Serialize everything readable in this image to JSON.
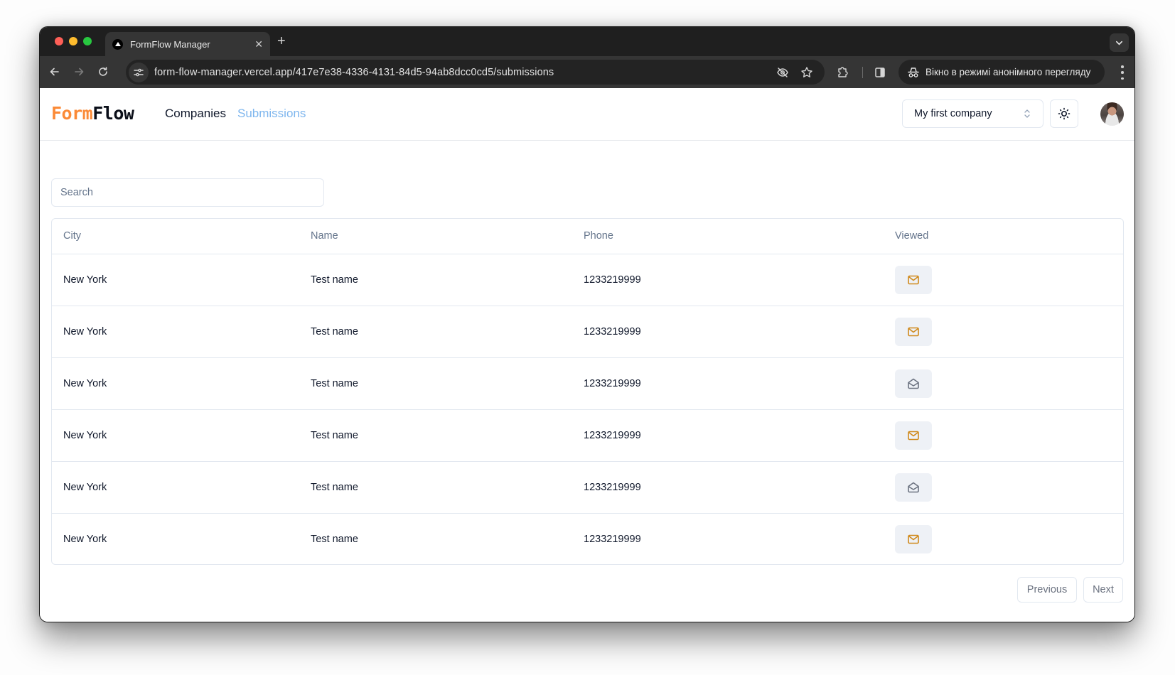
{
  "browser": {
    "tab_title": "FormFlow Manager",
    "url": "form-flow-manager.vercel.app/417e7e38-4336-4131-84d5-94ab8dcc0cd5/submissions",
    "incognito_label": "Вікно в режимі анонімного перегляду"
  },
  "app": {
    "logo_part1": "Form",
    "logo_part2": "Flow",
    "nav": {
      "companies": "Companies",
      "submissions": "Submissions"
    },
    "company_select": "My first company",
    "accent_colors": {
      "logo_orange": "#fb8a37",
      "active_nav": "#7eb6ee",
      "unread_icon": "#d08a1c",
      "read_icon": "#6b7280"
    }
  },
  "search": {
    "placeholder": "Search",
    "value": ""
  },
  "table": {
    "columns": [
      "City",
      "Name",
      "Phone",
      "Viewed"
    ],
    "rows": [
      {
        "city": "New York",
        "name": "Test name",
        "phone": "1233219999",
        "viewed": false
      },
      {
        "city": "New York",
        "name": "Test name",
        "phone": "1233219999",
        "viewed": false
      },
      {
        "city": "New York",
        "name": "Test name",
        "phone": "1233219999",
        "viewed": true
      },
      {
        "city": "New York",
        "name": "Test name",
        "phone": "1233219999",
        "viewed": false
      },
      {
        "city": "New York",
        "name": "Test name",
        "phone": "1233219999",
        "viewed": true
      },
      {
        "city": "New York",
        "name": "Test name",
        "phone": "1233219999",
        "viewed": false
      }
    ]
  },
  "pagination": {
    "previous": "Previous",
    "next": "Next"
  }
}
